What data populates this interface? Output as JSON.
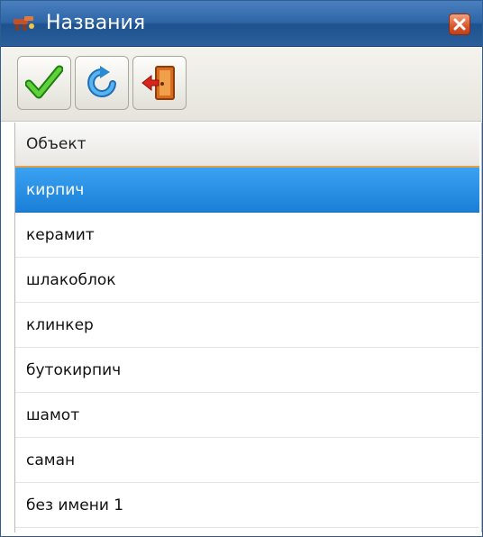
{
  "window": {
    "title": "Названия",
    "app_icon": "tools-icon",
    "close_icon": "close-icon"
  },
  "toolbar": {
    "buttons": [
      {
        "name": "apply",
        "icon": "checkmark-icon",
        "color": "#3cb521"
      },
      {
        "name": "refresh",
        "icon": "refresh-icon",
        "color": "#2a8ad4"
      },
      {
        "name": "exit",
        "icon": "exit-door-icon",
        "color": "#d9531e"
      }
    ]
  },
  "list": {
    "header": "Объект",
    "selected_index": 0,
    "items": [
      "кирпич",
      "керамит",
      "шлакоблок",
      "клинкер",
      "бутокирпич",
      "шамот",
      "саман",
      "без имени 1"
    ]
  },
  "colors": {
    "titlebar": "#2e65a6",
    "selection": "#1a7fd7",
    "header_accent": "#e2a04a"
  }
}
